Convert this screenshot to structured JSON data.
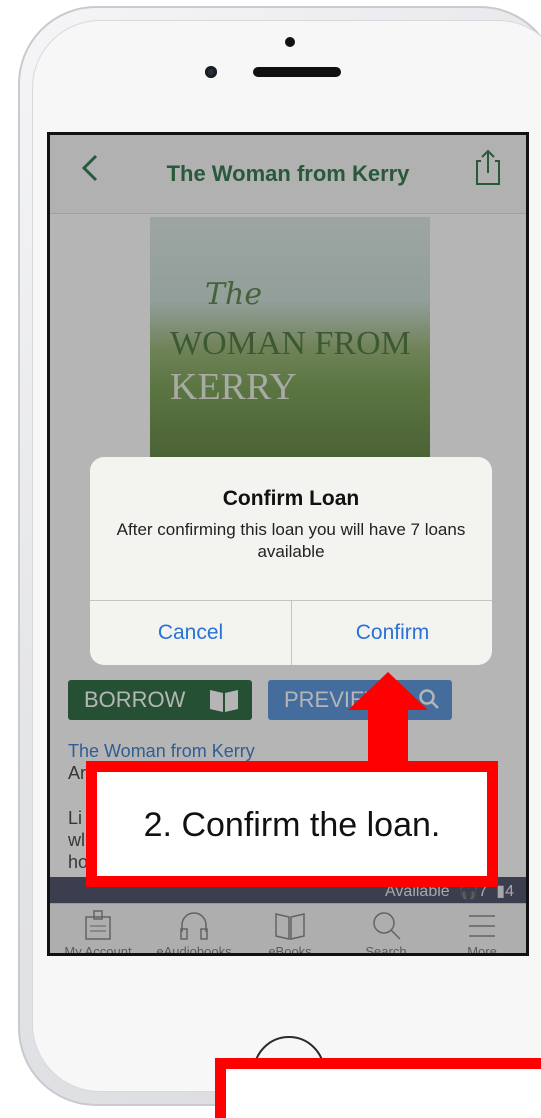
{
  "screen": {
    "nav": {
      "title": "The Woman from Kerry"
    },
    "cover": {
      "line1": "The",
      "line2": "WOMAN FROM",
      "line3": "KERRY"
    },
    "buttons": {
      "borrow": "BORROW",
      "preview": "PREVIEW"
    },
    "details": {
      "title_link": "The Woman from Kerry",
      "author_stub": "Ar",
      "desc_lines": [
        "Li",
        "wl",
        "ho"
      ]
    },
    "availability": {
      "text": "Available",
      "audio_count": "7",
      "ebook_count": "4"
    },
    "tabs": [
      {
        "label": "My Account",
        "icon": "account-card-icon"
      },
      {
        "label": "eAudiobooks",
        "icon": "headphones-icon"
      },
      {
        "label": "eBooks",
        "icon": "book-icon"
      },
      {
        "label": "Search",
        "icon": "search-icon"
      },
      {
        "label": "More",
        "icon": "menu-icon"
      }
    ]
  },
  "dialog": {
    "title": "Confirm Loan",
    "message": "After confirming this loan you will have 7 loans available",
    "cancel": "Cancel",
    "confirm": "Confirm"
  },
  "annotation": {
    "text": "2. Confirm the loan.",
    "color": "#ff0000"
  },
  "colors": {
    "brand_green": "#1e6b3a",
    "borrow_bg": "#175d2f",
    "preview_bg": "#4a8ad8",
    "link_blue": "#2a72d6"
  }
}
